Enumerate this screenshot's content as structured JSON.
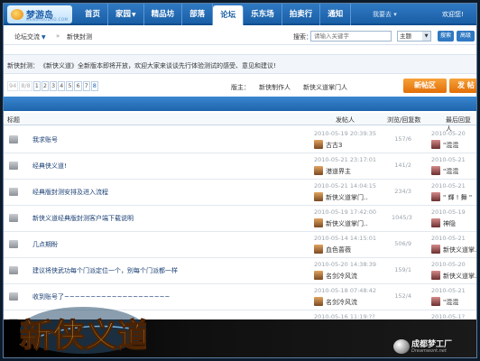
{
  "logo": {
    "name": "梦游岛",
    "subtitle": "MENGYOUDAO.COM"
  },
  "nav": {
    "items": [
      {
        "label": "首页",
        "caret": false
      },
      {
        "label": "家园",
        "caret": true
      },
      {
        "label": "精品坊",
        "caret": false
      },
      {
        "label": "部落",
        "caret": false
      },
      {
        "label": "论坛",
        "caret": false,
        "active": true
      },
      {
        "label": "乐东场",
        "caret": false
      },
      {
        "label": "拍卖行",
        "caret": false
      },
      {
        "label": "通知",
        "caret": false
      }
    ],
    "user": "我要去 ▾",
    "welcome": "欢迎您!"
  },
  "breadcrumb": {
    "forum": "论坛交流",
    "forum_caret": "▼",
    "separator": "»",
    "board": "新侠封测"
  },
  "search": {
    "label": "搜索：",
    "placeholder": "请输入关键字",
    "scope": "主题",
    "button": "搜索",
    "advanced": "高级"
  },
  "notice": {
    "label": "新侠封测：",
    "text": "《新侠义道》全新版本即将开放，欢迎大家来谈谈先行体验测试的感受、意见和建议!"
  },
  "pager": {
    "prev": "94",
    "total": "8/8",
    "pages": [
      "1",
      "2",
      "3",
      "4",
      "5",
      "6",
      "7",
      "8"
    ],
    "current": "8"
  },
  "moderators": {
    "label": "版主：",
    "list": [
      "新侠制作人",
      "新侠义道掌门人"
    ]
  },
  "actions": {
    "new_post": "新帖区",
    "reply": "发 帖"
  },
  "table": {
    "headers": {
      "title": "标题",
      "author": "发帖人",
      "counts": "浏览/回复数",
      "last": "最后回复人"
    },
    "rows": [
      {
        "title": "我求账号",
        "author_date": "2010-05-19 20:39:35",
        "author": "古古3",
        "counts": "157/6",
        "last_date": "2010-05-20",
        "last_user": "\"混混"
      },
      {
        "title": "经典侠义道!",
        "author_date": "2010-05-21 23:17:01",
        "author": "港道界主",
        "counts": "141/2",
        "last_date": "2010-05-21",
        "last_user": "\"混混"
      },
      {
        "title": "经典版封测安排及进入流程",
        "author_date": "2010-05-21 14:04:15",
        "author": "新侠义道掌门..",
        "counts": "234/3",
        "last_date": "2010-05-21",
        "last_user": "\" 輝 ! 舞 \""
      },
      {
        "title": "新侠义道经典版封测客户端下载说明",
        "author_date": "2010-05-19 17:42:00",
        "author": "新侠义道掌门..",
        "counts": "1045/3",
        "last_date": "2010-05-19",
        "last_user": "神隐"
      },
      {
        "title": "几点期盼",
        "author_date": "2010-05-14 14:15:01",
        "author": "血色蔷薇",
        "counts": "506/9",
        "last_date": "2010-05-21",
        "last_user": "新侠义道掌.."
      },
      {
        "title": "建议将侠武功每个门派定位一个，别每个门派都一样",
        "author_date": "2010-05-20 14:38:39",
        "author": "名剑冷风流",
        "counts": "159/1",
        "last_date": "2010-05-20",
        "last_user": "新侠义道掌.."
      },
      {
        "title": "收到账号了~~~~~~~~~~~~~~~~~~~~",
        "author_date": "2010-05-18 07:48:42",
        "author": "名剑冷风流",
        "counts": "152/4",
        "last_date": "2010-05-21",
        "last_user": "\"混混"
      },
      {
        "title": "",
        "author_date": "2010-05-16 11:19:??",
        "author": "",
        "counts": "",
        "last_date": "2010-05-1?",
        "last_user": ""
      }
    ]
  },
  "banner": {
    "title": "新侠义道",
    "studio": "成都梦工厂",
    "studio_sub": "Dreamwork.net"
  },
  "colors": {
    "nav": "#1a5fa6",
    "accent_orange": "#e26e06",
    "link": "#1a3f73"
  }
}
